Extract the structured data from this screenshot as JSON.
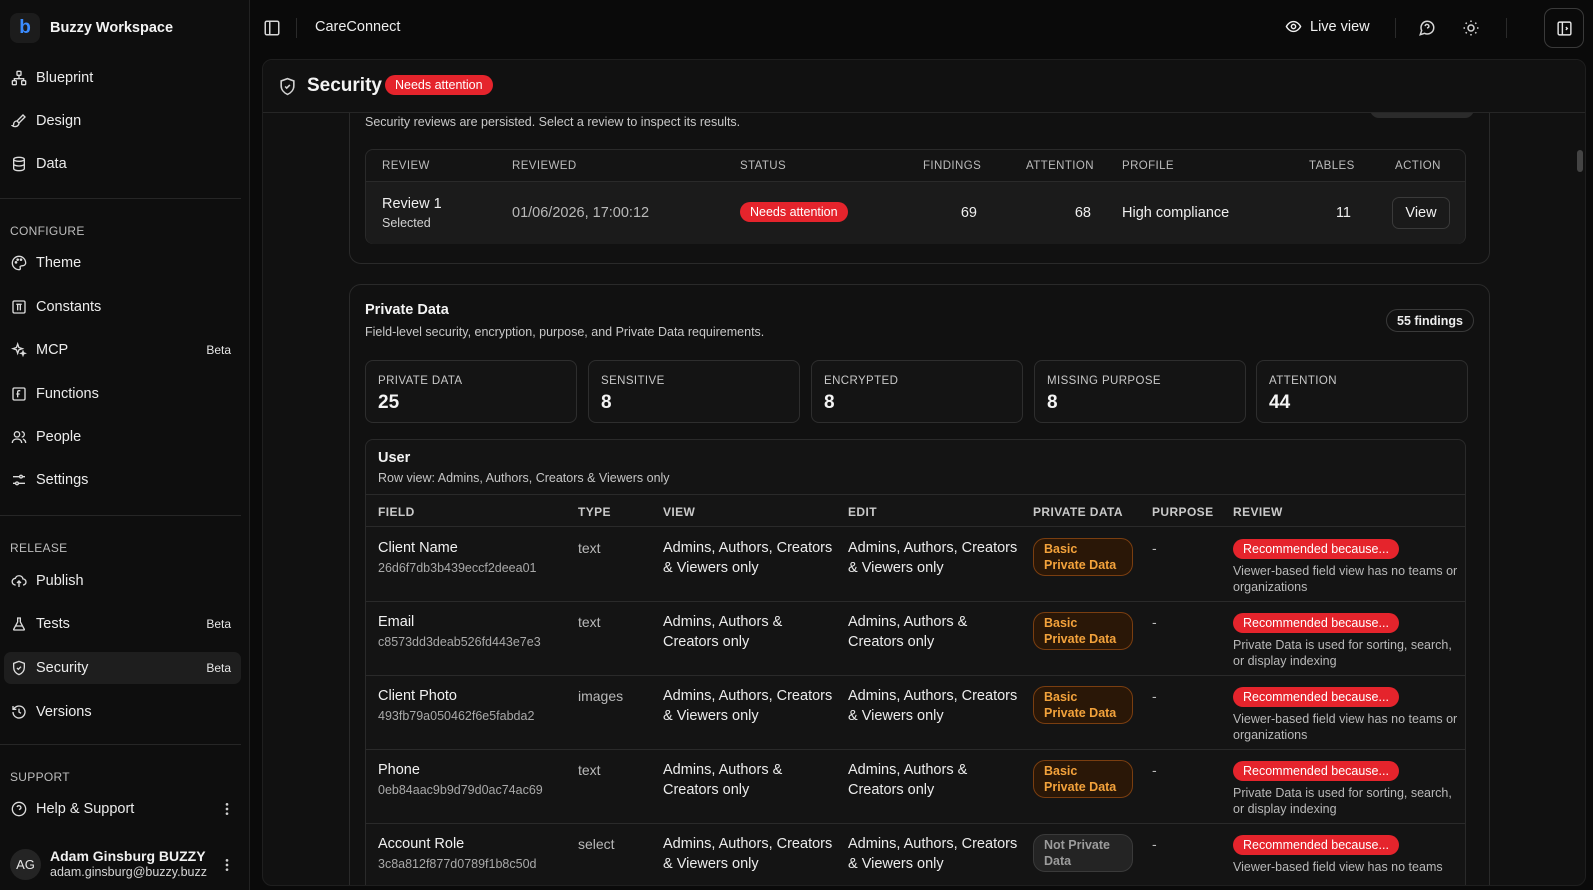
{
  "workspace": {
    "logo_letter": "b",
    "name": "Buzzy Workspace"
  },
  "nav": {
    "top": [
      {
        "label": "Blueprint",
        "icon": "blueprint-icon"
      },
      {
        "label": "Design",
        "icon": "brush-icon"
      },
      {
        "label": "Data",
        "icon": "database-icon"
      }
    ],
    "configure_label": "CONFIGURE",
    "configure": [
      {
        "label": "Theme",
        "icon": "palette-icon",
        "badge": ""
      },
      {
        "label": "Constants",
        "icon": "constants-icon",
        "badge": ""
      },
      {
        "label": "MCP",
        "icon": "sparkle-icon",
        "badge": "Beta"
      },
      {
        "label": "Functions",
        "icon": "function-icon",
        "badge": ""
      },
      {
        "label": "People",
        "icon": "people-icon",
        "badge": ""
      },
      {
        "label": "Settings",
        "icon": "sliders-icon",
        "badge": ""
      }
    ],
    "release_label": "RELEASE",
    "release": [
      {
        "label": "Publish",
        "icon": "cloud-upload-icon",
        "badge": ""
      },
      {
        "label": "Tests",
        "icon": "flask-icon",
        "badge": "Beta"
      },
      {
        "label": "Security",
        "icon": "shield-icon",
        "badge": "Beta",
        "active": true
      },
      {
        "label": "Versions",
        "icon": "history-icon",
        "badge": ""
      }
    ],
    "support_label": "SUPPORT",
    "support": [
      {
        "label": "Help & Support",
        "icon": "help-icon"
      }
    ]
  },
  "user": {
    "initials": "AG",
    "name": "Adam Ginsburg BUZZY",
    "email": "adam.ginsburg@buzzy.buzz"
  },
  "topbar": {
    "app_name": "CareConnect",
    "live_view": "Live view"
  },
  "page": {
    "title": "Security",
    "status": "Needs attention"
  },
  "reviews": {
    "description": "Security reviews are persisted. Select a review to inspect its results.",
    "columns": [
      "REVIEW",
      "REVIEWED",
      "STATUS",
      "FINDINGS",
      "ATTENTION",
      "PROFILE",
      "TABLES",
      "ACTION"
    ],
    "row": {
      "name": "Review 1",
      "sub": "Selected",
      "reviewed": "01/06/2026, 17:00:12",
      "status": "Needs attention",
      "findings": "69",
      "attention": "68",
      "profile": "High compliance",
      "tables": "11",
      "action": "View"
    }
  },
  "private_data": {
    "title": "Private Data",
    "description": "Field-level security, encryption, purpose, and Private Data requirements.",
    "findings_badge": "55 findings",
    "stats": [
      {
        "label": "PRIVATE DATA",
        "value": "25"
      },
      {
        "label": "SENSITIVE",
        "value": "8"
      },
      {
        "label": "ENCRYPTED",
        "value": "8"
      },
      {
        "label": "MISSING PURPOSE",
        "value": "8"
      },
      {
        "label": "ATTENTION",
        "value": "44"
      }
    ],
    "table": {
      "name": "User",
      "subtitle": "Row view: Admins, Authors, Creators & Viewers only",
      "columns": [
        "FIELD",
        "TYPE",
        "VIEW",
        "EDIT",
        "PRIVATE DATA",
        "PURPOSE",
        "REVIEW"
      ],
      "rows": [
        {
          "field": "Client Name",
          "id": "26d6f7db3b439eccf2deea01",
          "type": "text",
          "view": "Admins, Authors, Creators & Viewers only",
          "edit": "Admins, Authors, Creators & Viewers only",
          "private": "Basic Private Data",
          "private_kind": "basic",
          "purpose": "-",
          "review": "Recommended because...",
          "reason": "Viewer-based field view has no teams or organizations"
        },
        {
          "field": "Email",
          "id": "c8573dd3deab526fd443e7e3",
          "type": "text",
          "view": "Admins, Authors & Creators only",
          "edit": "Admins, Authors & Creators only",
          "private": "Basic Private Data",
          "private_kind": "basic",
          "purpose": "-",
          "review": "Recommended because...",
          "reason": "Private Data is used for sorting, search, or display indexing"
        },
        {
          "field": "Client Photo",
          "id": "493fb79a050462f6e5fabda2",
          "type": "images",
          "view": "Admins, Authors, Creators & Viewers only",
          "edit": "Admins, Authors, Creators & Viewers only",
          "private": "Basic Private Data",
          "private_kind": "basic",
          "purpose": "-",
          "review": "Recommended because...",
          "reason": "Viewer-based field view has no teams or organizations"
        },
        {
          "field": "Phone",
          "id": "0eb84aac9b9d79d0ac74ac69",
          "type": "text",
          "view": "Admins, Authors & Creators only",
          "edit": "Admins, Authors & Creators only",
          "private": "Basic Private Data",
          "private_kind": "basic",
          "purpose": "-",
          "review": "Recommended because...",
          "reason": "Private Data is used for sorting, search, or display indexing"
        },
        {
          "field": "Account Role",
          "id": "3c8a812f877d0789f1b8c50d",
          "type": "select",
          "view": "Admins, Authors, Creators & Viewers only",
          "edit": "Admins, Authors, Creators & Viewers only",
          "private": "Not Private Data",
          "private_kind": "none",
          "purpose": "-",
          "review": "Recommended because...",
          "reason": "Viewer-based field view has no teams"
        }
      ]
    }
  },
  "colors": {
    "danger": "#e5242c",
    "warning": "#f3a23b",
    "brand": "#3b8cff"
  }
}
